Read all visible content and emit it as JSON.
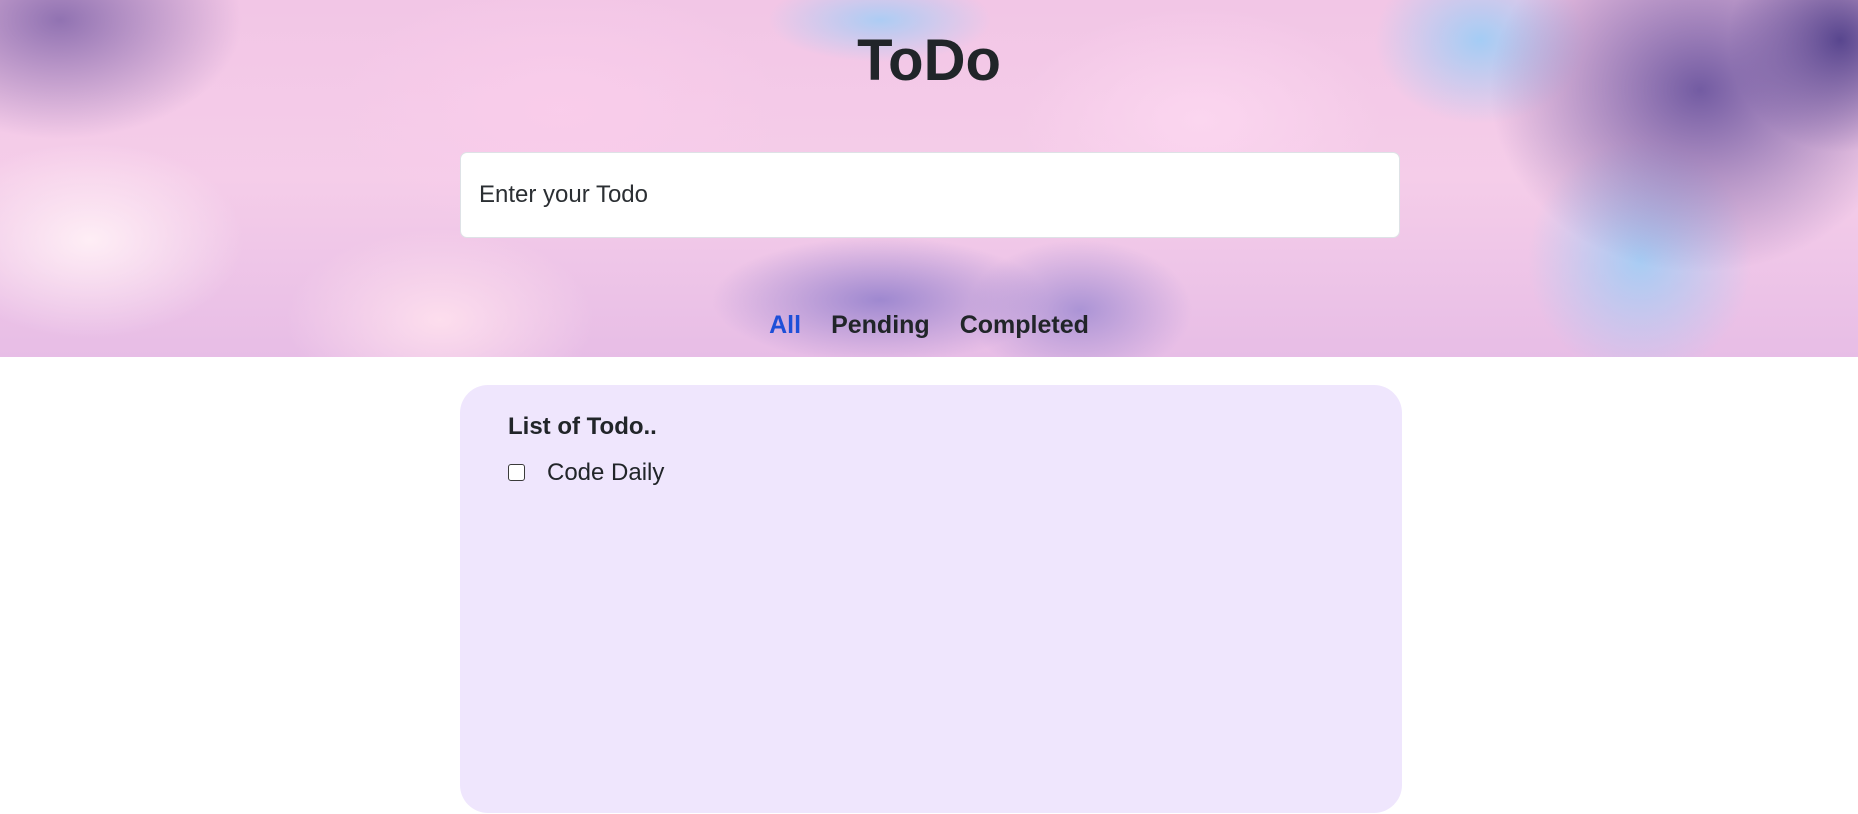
{
  "header": {
    "title": "ToDo"
  },
  "todo_input": {
    "value": "",
    "placeholder": "Enter your Todo"
  },
  "filters": {
    "tabs": [
      {
        "label": "All",
        "active": true
      },
      {
        "label": "Pending",
        "active": false
      },
      {
        "label": "Completed",
        "active": false
      }
    ],
    "active_color": "#1d4fd8"
  },
  "todo_list": {
    "heading": "List of Todo..",
    "items": [
      {
        "label": "Code Daily",
        "checked": false
      }
    ]
  },
  "colors": {
    "card_background": "#efe6fd",
    "text": "#212529"
  }
}
